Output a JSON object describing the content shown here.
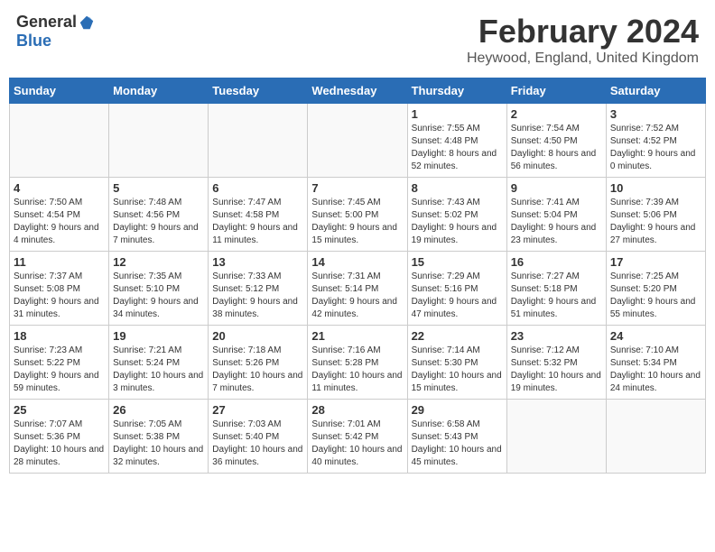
{
  "header": {
    "logo_general": "General",
    "logo_blue": "Blue",
    "title": "February 2024",
    "subtitle": "Heywood, England, United Kingdom"
  },
  "days_of_week": [
    "Sunday",
    "Monday",
    "Tuesday",
    "Wednesday",
    "Thursday",
    "Friday",
    "Saturday"
  ],
  "weeks": [
    [
      {
        "day": "",
        "info": ""
      },
      {
        "day": "",
        "info": ""
      },
      {
        "day": "",
        "info": ""
      },
      {
        "day": "",
        "info": ""
      },
      {
        "day": "1",
        "info": "Sunrise: 7:55 AM\nSunset: 4:48 PM\nDaylight: 8 hours and 52 minutes."
      },
      {
        "day": "2",
        "info": "Sunrise: 7:54 AM\nSunset: 4:50 PM\nDaylight: 8 hours and 56 minutes."
      },
      {
        "day": "3",
        "info": "Sunrise: 7:52 AM\nSunset: 4:52 PM\nDaylight: 9 hours and 0 minutes."
      }
    ],
    [
      {
        "day": "4",
        "info": "Sunrise: 7:50 AM\nSunset: 4:54 PM\nDaylight: 9 hours and 4 minutes."
      },
      {
        "day": "5",
        "info": "Sunrise: 7:48 AM\nSunset: 4:56 PM\nDaylight: 9 hours and 7 minutes."
      },
      {
        "day": "6",
        "info": "Sunrise: 7:47 AM\nSunset: 4:58 PM\nDaylight: 9 hours and 11 minutes."
      },
      {
        "day": "7",
        "info": "Sunrise: 7:45 AM\nSunset: 5:00 PM\nDaylight: 9 hours and 15 minutes."
      },
      {
        "day": "8",
        "info": "Sunrise: 7:43 AM\nSunset: 5:02 PM\nDaylight: 9 hours and 19 minutes."
      },
      {
        "day": "9",
        "info": "Sunrise: 7:41 AM\nSunset: 5:04 PM\nDaylight: 9 hours and 23 minutes."
      },
      {
        "day": "10",
        "info": "Sunrise: 7:39 AM\nSunset: 5:06 PM\nDaylight: 9 hours and 27 minutes."
      }
    ],
    [
      {
        "day": "11",
        "info": "Sunrise: 7:37 AM\nSunset: 5:08 PM\nDaylight: 9 hours and 31 minutes."
      },
      {
        "day": "12",
        "info": "Sunrise: 7:35 AM\nSunset: 5:10 PM\nDaylight: 9 hours and 34 minutes."
      },
      {
        "day": "13",
        "info": "Sunrise: 7:33 AM\nSunset: 5:12 PM\nDaylight: 9 hours and 38 minutes."
      },
      {
        "day": "14",
        "info": "Sunrise: 7:31 AM\nSunset: 5:14 PM\nDaylight: 9 hours and 42 minutes."
      },
      {
        "day": "15",
        "info": "Sunrise: 7:29 AM\nSunset: 5:16 PM\nDaylight: 9 hours and 47 minutes."
      },
      {
        "day": "16",
        "info": "Sunrise: 7:27 AM\nSunset: 5:18 PM\nDaylight: 9 hours and 51 minutes."
      },
      {
        "day": "17",
        "info": "Sunrise: 7:25 AM\nSunset: 5:20 PM\nDaylight: 9 hours and 55 minutes."
      }
    ],
    [
      {
        "day": "18",
        "info": "Sunrise: 7:23 AM\nSunset: 5:22 PM\nDaylight: 9 hours and 59 minutes."
      },
      {
        "day": "19",
        "info": "Sunrise: 7:21 AM\nSunset: 5:24 PM\nDaylight: 10 hours and 3 minutes."
      },
      {
        "day": "20",
        "info": "Sunrise: 7:18 AM\nSunset: 5:26 PM\nDaylight: 10 hours and 7 minutes."
      },
      {
        "day": "21",
        "info": "Sunrise: 7:16 AM\nSunset: 5:28 PM\nDaylight: 10 hours and 11 minutes."
      },
      {
        "day": "22",
        "info": "Sunrise: 7:14 AM\nSunset: 5:30 PM\nDaylight: 10 hours and 15 minutes."
      },
      {
        "day": "23",
        "info": "Sunrise: 7:12 AM\nSunset: 5:32 PM\nDaylight: 10 hours and 19 minutes."
      },
      {
        "day": "24",
        "info": "Sunrise: 7:10 AM\nSunset: 5:34 PM\nDaylight: 10 hours and 24 minutes."
      }
    ],
    [
      {
        "day": "25",
        "info": "Sunrise: 7:07 AM\nSunset: 5:36 PM\nDaylight: 10 hours and 28 minutes."
      },
      {
        "day": "26",
        "info": "Sunrise: 7:05 AM\nSunset: 5:38 PM\nDaylight: 10 hours and 32 minutes."
      },
      {
        "day": "27",
        "info": "Sunrise: 7:03 AM\nSunset: 5:40 PM\nDaylight: 10 hours and 36 minutes."
      },
      {
        "day": "28",
        "info": "Sunrise: 7:01 AM\nSunset: 5:42 PM\nDaylight: 10 hours and 40 minutes."
      },
      {
        "day": "29",
        "info": "Sunrise: 6:58 AM\nSunset: 5:43 PM\nDaylight: 10 hours and 45 minutes."
      },
      {
        "day": "",
        "info": ""
      },
      {
        "day": "",
        "info": ""
      }
    ]
  ]
}
